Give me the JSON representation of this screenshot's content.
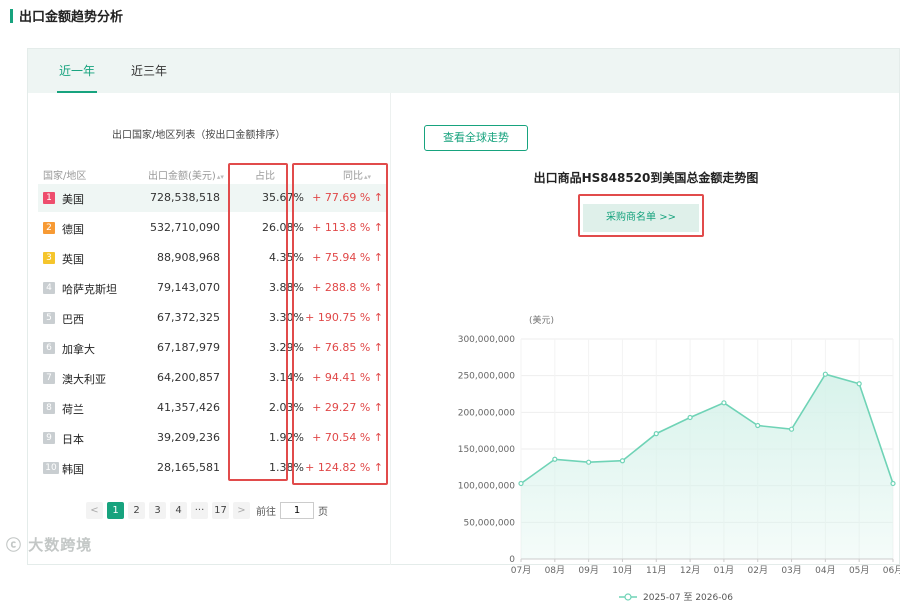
{
  "section_title": "出口金额趋势分析",
  "tabs": [
    {
      "label": "近一年",
      "active": true
    },
    {
      "label": "近三年",
      "active": false
    }
  ],
  "list": {
    "title": "出口国家/地区列表（按出口金额排序）",
    "headers": {
      "country": "国家/地区",
      "amount": "出口金额(美元)",
      "ratio": "占比",
      "yoy": "同比"
    },
    "rows": [
      {
        "rank": "1",
        "country": "美国",
        "amount": "728,538,518",
        "ratio": "35.67%",
        "yoy": "+ 77.69 %"
      },
      {
        "rank": "2",
        "country": "德国",
        "amount": "532,710,090",
        "ratio": "26.08%",
        "yoy": "+ 113.8 %"
      },
      {
        "rank": "3",
        "country": "英国",
        "amount": "88,908,968",
        "ratio": "4.35%",
        "yoy": "+ 75.94 %"
      },
      {
        "rank": "4",
        "country": "哈萨克斯坦",
        "amount": "79,143,070",
        "ratio": "3.88%",
        "yoy": "+ 288.8 %"
      },
      {
        "rank": "5",
        "country": "巴西",
        "amount": "67,372,325",
        "ratio": "3.30%",
        "yoy": "+ 190.75 %"
      },
      {
        "rank": "6",
        "country": "加拿大",
        "amount": "67,187,979",
        "ratio": "3.29%",
        "yoy": "+ 76.85 %"
      },
      {
        "rank": "7",
        "country": "澳大利亚",
        "amount": "64,200,857",
        "ratio": "3.14%",
        "yoy": "+ 94.41 %"
      },
      {
        "rank": "8",
        "country": "荷兰",
        "amount": "41,357,426",
        "ratio": "2.03%",
        "yoy": "+ 29.27 %"
      },
      {
        "rank": "9",
        "country": "日本",
        "amount": "39,209,236",
        "ratio": "1.92%",
        "yoy": "+ 70.54 %"
      },
      {
        "rank": "10",
        "country": "韩国",
        "amount": "28,165,581",
        "ratio": "1.38%",
        "yoy": "+ 124.82 %"
      }
    ],
    "up_arrow": "↑"
  },
  "pagination": {
    "prev": "<",
    "pages": [
      "1",
      "2",
      "3",
      "4"
    ],
    "ellipsis": "···",
    "last": "17",
    "next": ">",
    "goto_label": "前往",
    "goto_value": "1",
    "page_unit": "页"
  },
  "global_trend_button": "查看全球走势",
  "chart_title": "出口商品HS848520到美国总金额走势图",
  "buyer_list_button": "采购商名单 >>",
  "watermark": "大数跨境",
  "chart_data": {
    "type": "area",
    "title": "出口商品HS848520到美国总金额走势图",
    "unit": "(美元)",
    "x": [
      "07月",
      "08月",
      "09月",
      "10月",
      "11月",
      "12月",
      "01月",
      "02月",
      "03月",
      "04月",
      "05月",
      "06月"
    ],
    "series": [
      {
        "name": "2025-07 至 2026-06",
        "values": [
          103000000,
          136000000,
          132000000,
          134000000,
          171000000,
          193000000,
          213000000,
          182000000,
          177000000,
          252000000,
          239000000,
          103000000
        ]
      }
    ],
    "yticks": [
      "0",
      "50,000,000",
      "100,000,000",
      "150,000,000",
      "200,000,000",
      "250,000,000",
      "300,000,000"
    ],
    "ylim": [
      0,
      300000000
    ],
    "grid": true,
    "legend_position": "bottom",
    "line_color": "#6fd3b6",
    "fill_color": "#d6f2ea"
  }
}
